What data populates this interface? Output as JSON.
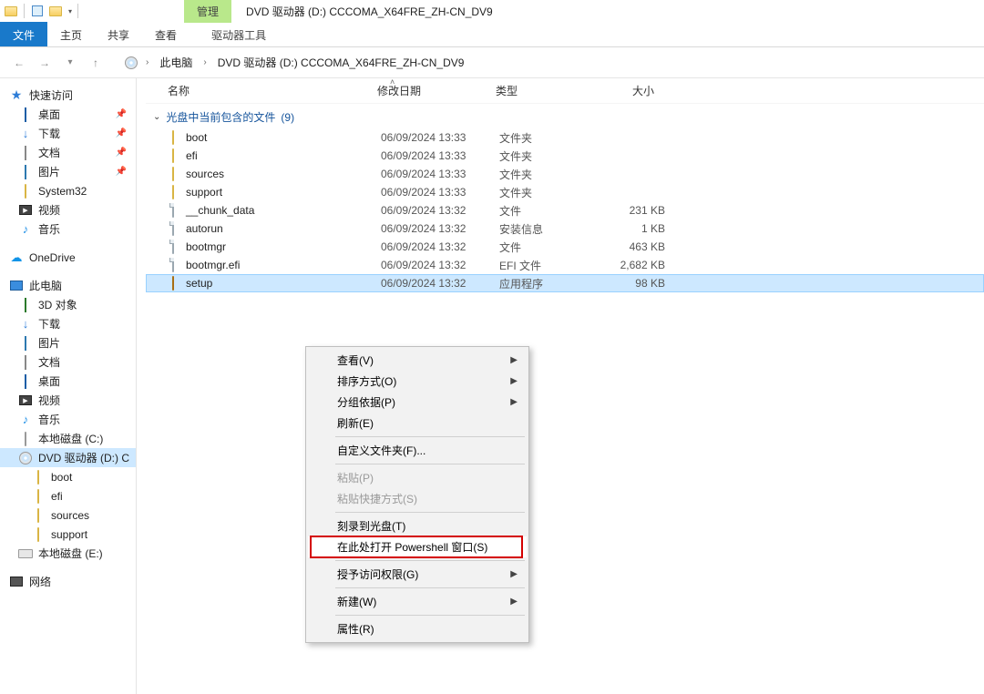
{
  "window": {
    "title": "DVD 驱动器 (D:) CCCOMA_X64FRE_ZH-CN_DV9",
    "manage_label": "管理"
  },
  "ribbon": {
    "file": "文件",
    "tabs": [
      "主页",
      "共享",
      "查看"
    ],
    "drive_tools": "驱动器工具"
  },
  "breadcrumb": {
    "root": "此电脑",
    "path": "DVD 驱动器 (D:) CCCOMA_X64FRE_ZH-CN_DV9"
  },
  "tree": {
    "quick_access": "快速访问",
    "quick_items": [
      {
        "label": "桌面",
        "icon": "desktop",
        "pinned": true
      },
      {
        "label": "下载",
        "icon": "down",
        "pinned": true
      },
      {
        "label": "文档",
        "icon": "doc",
        "pinned": true
      },
      {
        "label": "图片",
        "icon": "pic",
        "pinned": true
      },
      {
        "label": "System32",
        "icon": "folder",
        "pinned": false
      },
      {
        "label": "视频",
        "icon": "vid",
        "pinned": false
      },
      {
        "label": "音乐",
        "icon": "music",
        "pinned": false
      }
    ],
    "onedrive": "OneDrive",
    "this_pc": "此电脑",
    "pc_items": [
      {
        "label": "3D 对象",
        "icon": "3d"
      },
      {
        "label": "下载",
        "icon": "down"
      },
      {
        "label": "图片",
        "icon": "pic"
      },
      {
        "label": "文档",
        "icon": "doc"
      },
      {
        "label": "桌面",
        "icon": "desktop"
      },
      {
        "label": "视频",
        "icon": "vid"
      },
      {
        "label": "音乐",
        "icon": "music"
      },
      {
        "label": "本地磁盘 (C:)",
        "icon": "drive"
      }
    ],
    "dvd_drive": "DVD 驱动器 (D:) C",
    "dvd_children": [
      {
        "label": "boot"
      },
      {
        "label": "efi"
      },
      {
        "label": "sources"
      },
      {
        "label": "support"
      }
    ],
    "drive_e": "本地磁盘 (E:)",
    "network": "网络"
  },
  "columns": {
    "name": "名称",
    "date": "修改日期",
    "type": "类型",
    "size": "大小"
  },
  "group": {
    "title": "光盘中当前包含的文件",
    "count": "(9)"
  },
  "files": [
    {
      "name": "boot",
      "date": "06/09/2024 13:33",
      "type": "文件夹",
      "size": "",
      "icon": "folder"
    },
    {
      "name": "efi",
      "date": "06/09/2024 13:33",
      "type": "文件夹",
      "size": "",
      "icon": "folder"
    },
    {
      "name": "sources",
      "date": "06/09/2024 13:33",
      "type": "文件夹",
      "size": "",
      "icon": "folder"
    },
    {
      "name": "support",
      "date": "06/09/2024 13:33",
      "type": "文件夹",
      "size": "",
      "icon": "folder"
    },
    {
      "name": "__chunk_data",
      "date": "06/09/2024 13:32",
      "type": "文件",
      "size": "231 KB",
      "icon": "file"
    },
    {
      "name": "autorun",
      "date": "06/09/2024 13:32",
      "type": "安装信息",
      "size": "1 KB",
      "icon": "file"
    },
    {
      "name": "bootmgr",
      "date": "06/09/2024 13:32",
      "type": "文件",
      "size": "463 KB",
      "icon": "file"
    },
    {
      "name": "bootmgr.efi",
      "date": "06/09/2024 13:32",
      "type": "EFI 文件",
      "size": "2,682 KB",
      "icon": "file"
    },
    {
      "name": "setup",
      "date": "06/09/2024 13:32",
      "type": "应用程序",
      "size": "98 KB",
      "icon": "setup",
      "selected": true
    }
  ],
  "context_menu": [
    {
      "label": "查看(V)",
      "submenu": true
    },
    {
      "label": "排序方式(O)",
      "submenu": true
    },
    {
      "label": "分组依据(P)",
      "submenu": true
    },
    {
      "label": "刷新(E)"
    },
    {
      "sep": true
    },
    {
      "label": "自定义文件夹(F)..."
    },
    {
      "sep": true
    },
    {
      "label": "粘贴(P)",
      "disabled": true
    },
    {
      "label": "粘贴快捷方式(S)",
      "disabled": true
    },
    {
      "sep": true
    },
    {
      "label": "刻录到光盘(T)"
    },
    {
      "label": "在此处打开 Powershell 窗口(S)",
      "highlighted": true
    },
    {
      "sep": true
    },
    {
      "label": "授予访问权限(G)",
      "submenu": true
    },
    {
      "sep": true
    },
    {
      "label": "新建(W)",
      "submenu": true
    },
    {
      "sep": true
    },
    {
      "label": "属性(R)"
    }
  ]
}
